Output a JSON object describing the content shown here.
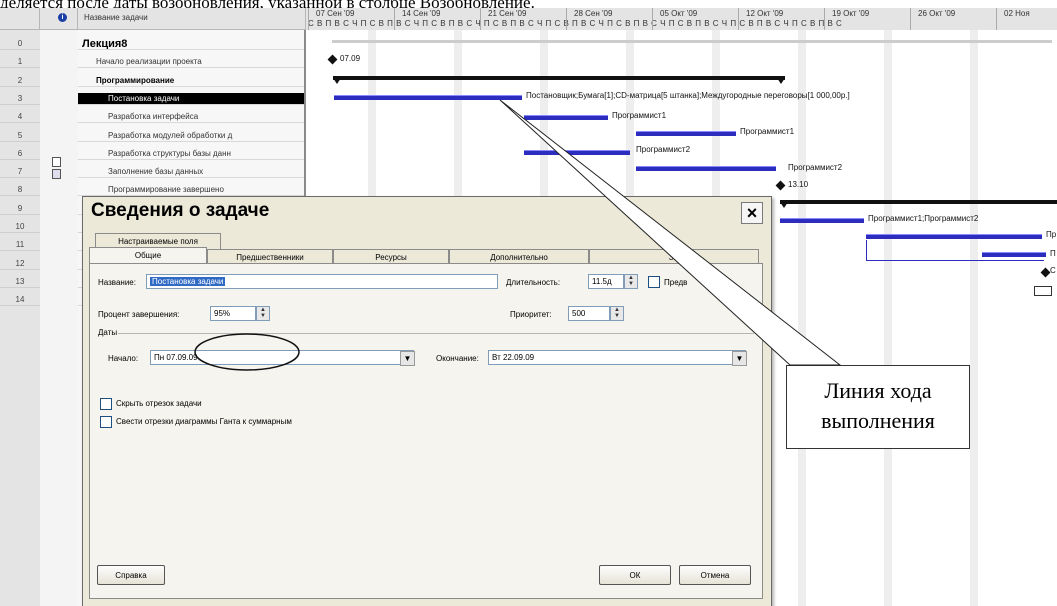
{
  "caption": "деляется после даты возобновления, указанной в столбце Возобновление.",
  "table": {
    "header_task_name": "Название задачи",
    "info_icon": "info-icon",
    "rows": [
      {
        "num": "0",
        "name": "Лекция8"
      },
      {
        "num": "1",
        "name": "Начало реализации проекта"
      },
      {
        "num": "2",
        "name": "Программирование"
      },
      {
        "num": "3",
        "name": "Постановка задачи"
      },
      {
        "num": "4",
        "name": "Разработка интерфейса"
      },
      {
        "num": "5",
        "name": "Разработка модулей обработки д"
      },
      {
        "num": "6",
        "name": "Разработка структуры базы данн"
      },
      {
        "num": "7",
        "name": "Заполнение базы данных"
      },
      {
        "num": "8",
        "name": "Программирование завершено"
      },
      {
        "num": "9",
        "name": ""
      },
      {
        "num": "10",
        "name": ""
      },
      {
        "num": "11",
        "name": ""
      },
      {
        "num": "12",
        "name": ""
      },
      {
        "num": "13",
        "name": ""
      },
      {
        "num": "14",
        "name": ""
      }
    ]
  },
  "timescale": {
    "weeks": [
      "07 Сен '09",
      "14 Сен '09",
      "21 Сен '09",
      "28 Сен '09",
      "05 Окт '09",
      "12 Окт '09",
      "19 Окт '09",
      "26 Окт '09",
      "02 Ноя"
    ],
    "days": "С В П В С Ч П С В П В С Ч П С В П В С Ч П С В П В С Ч П С В П В С Ч П С В П В С Ч П С В П В С Ч П С В П В С Ч П С В П В С"
  },
  "gantt": {
    "milestone1_label": "07.09",
    "task3_resources": "Постановщик;Бумага[1];CD-матрица[5 штанка];Междугородные переговоры[1 000,00р.]",
    "task4_resource": "Программист1",
    "task5_resource": "Программист1",
    "task6_resource": "Программист2",
    "task7_resource": "Программист2",
    "milestone2_label": "13.10",
    "task11_resource": "Программист1;Программист2",
    "cut_label_1": "Пр",
    "cut_label_2": "П",
    "cut_label_3": "С"
  },
  "dialog": {
    "title": "Сведения о задаче",
    "close": "×",
    "tabs_row1": [
      "Настраиваемые поля"
    ],
    "tabs_row2": [
      "Общие",
      "Предшественники",
      "Ресурсы",
      "Дополнительно",
      "За"
    ],
    "name_label": "Название:",
    "name_value": "Постановка задачи",
    "duration_label": "Длительность:",
    "duration_value": "11.5д",
    "estimated_label": "Предв",
    "percent_label": "Процент завершения:",
    "percent_value": "95%",
    "priority_label": "Приоритет:",
    "priority_value": "500",
    "dates_group": "Даты",
    "start_label": "Начало:",
    "start_value": "Пн 07.09.09",
    "finish_label": "Окончание:",
    "finish_value": "Вт 22.09.09",
    "hide_bar_label": "Скрыть отрезок задачи",
    "rollup_label": "Свести отрезки диаграммы Ганта к суммарным",
    "help_button": "Справка",
    "ok_button": "ОК",
    "cancel_button": "Отмена"
  },
  "callout": {
    "line1": "Линия хода",
    "line2": "выполнения"
  }
}
